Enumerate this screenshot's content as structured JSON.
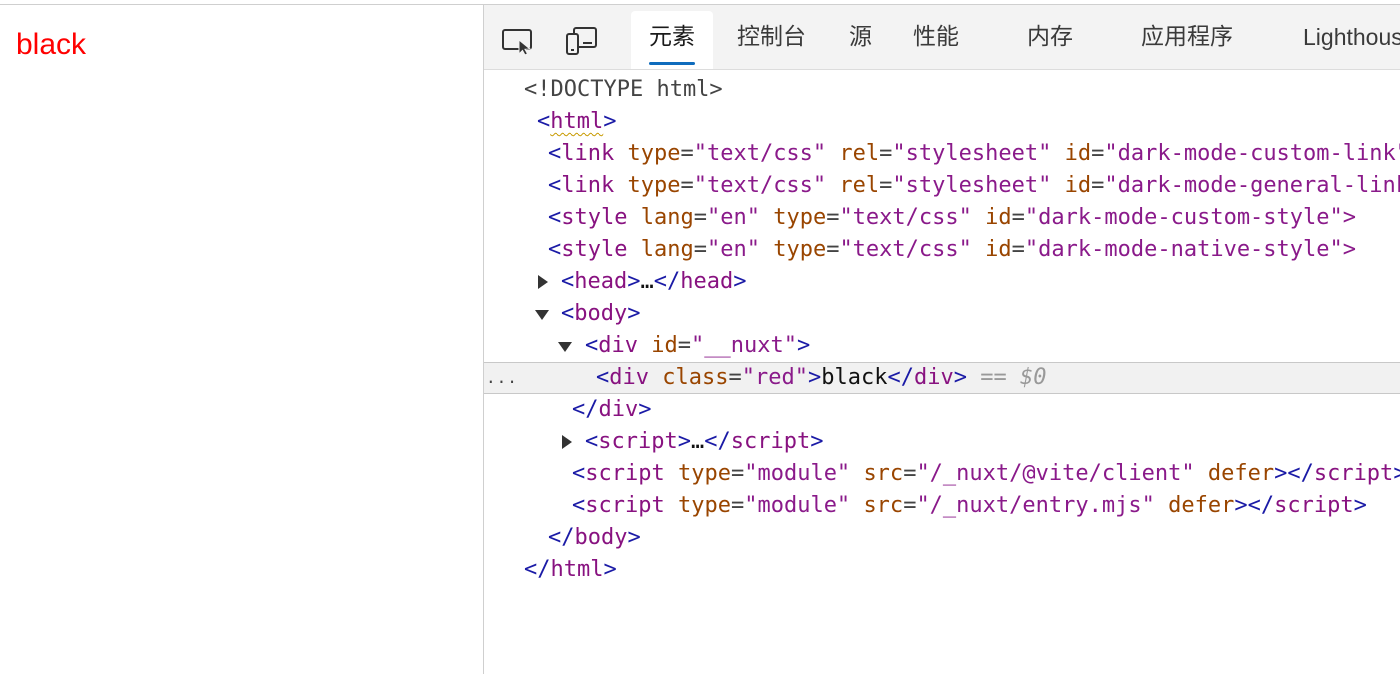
{
  "page": {
    "rendered_text": "black"
  },
  "devtools": {
    "toolbar": {
      "inspect_icon": "inspect-element-icon",
      "device_icon": "device-emulation-icon",
      "tabs": [
        {
          "label": "元素",
          "active": true
        },
        {
          "label": "控制台",
          "active": false
        },
        {
          "label": "源",
          "active": false
        },
        {
          "label": "性能",
          "active": false
        },
        {
          "label": "内存",
          "active": false
        },
        {
          "label": "应用程序",
          "active": false
        },
        {
          "label": "Lighthouse",
          "active": false
        }
      ]
    },
    "tree": {
      "doctype": "<!DOCTYPE html>",
      "html_open": "html",
      "link1": {
        "tag": "link",
        "a1": "type",
        "v1": "\"text/css\"",
        "a2": "rel",
        "v2": "\"stylesheet\"",
        "a3": "id",
        "v3": "\"dark-mode-custom-link\">"
      },
      "link2": {
        "tag": "link",
        "a1": "type",
        "v1": "\"text/css\"",
        "a2": "rel",
        "v2": "\"stylesheet\"",
        "a3": "id",
        "v3": "\"dark-mode-general-link\">"
      },
      "style1": {
        "tag": "style",
        "a1": "lang",
        "v1": "\"en\"",
        "a2": "type",
        "v2": "\"text/css\"",
        "a3": "id",
        "v3": "\"dark-mode-custom-style\">"
      },
      "style2": {
        "tag": "style",
        "a1": "lang",
        "v1": "\"en\"",
        "a2": "type",
        "v2": "\"text/css\"",
        "a3": "id",
        "v3": "\"dark-mode-native-style\">"
      },
      "head": {
        "open": "head",
        "ellipsis": "…",
        "close": "head"
      },
      "body_open": "body",
      "div_nuxt": {
        "tag": "div",
        "attr": "id",
        "val": "\"__nuxt\""
      },
      "selected": {
        "gutter": "...",
        "tag": "div",
        "attr": "class",
        "val": "\"red\"",
        "text": "black",
        "close": "div",
        "eq": "==",
        "ref": "$0"
      },
      "div_close": "div",
      "script_collapsed": {
        "open": "script",
        "ellipsis": "…",
        "close": "script"
      },
      "script1": {
        "tag": "script",
        "a1": "type",
        "v1": "\"module\"",
        "a2": "src",
        "v2": "\"/_nuxt/@vite/client\"",
        "a3": "defer",
        "close": "script"
      },
      "script2": {
        "tag": "script",
        "a1": "type",
        "v1": "\"module\"",
        "a2": "src",
        "v2": "\"/_nuxt/entry.mjs\"",
        "a3": "defer",
        "close": "script"
      },
      "body_close": "body",
      "html_close": "html"
    }
  }
}
